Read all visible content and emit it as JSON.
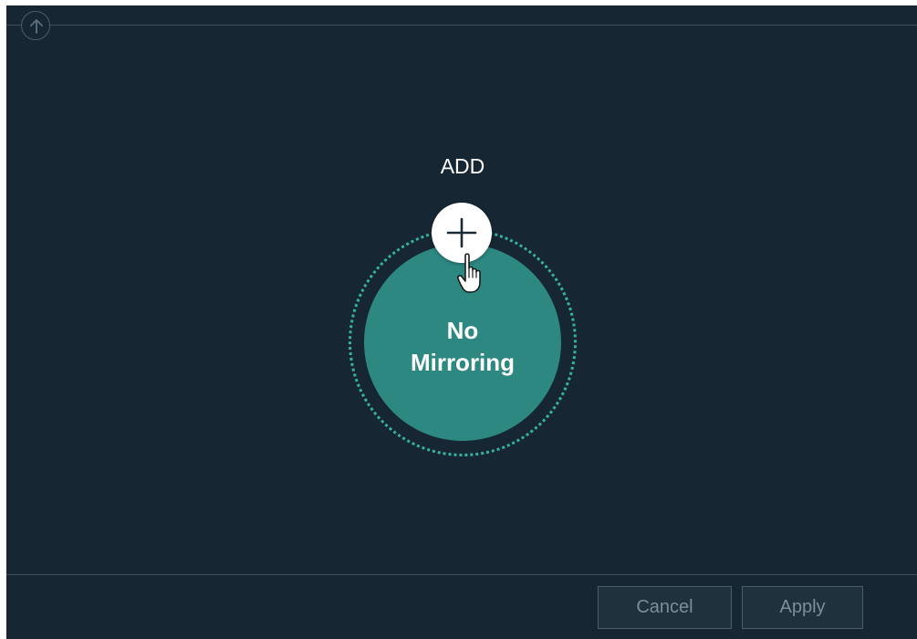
{
  "main": {
    "add_label": "ADD",
    "mirroring_status": {
      "line1": "No",
      "line2": "Mirroring"
    }
  },
  "icons": {
    "scroll_up": "arrow-up-circle-icon",
    "add": "plus-icon",
    "cursor": "hand-pointer-cursor"
  },
  "footer": {
    "cancel_label": "Cancel",
    "apply_label": "Apply"
  },
  "colors": {
    "background": "#162733",
    "circle_fill": "#2e8882",
    "ring_dotted": "#35b3a0",
    "text": "#ffffff",
    "button_text": "#7d8e99"
  }
}
